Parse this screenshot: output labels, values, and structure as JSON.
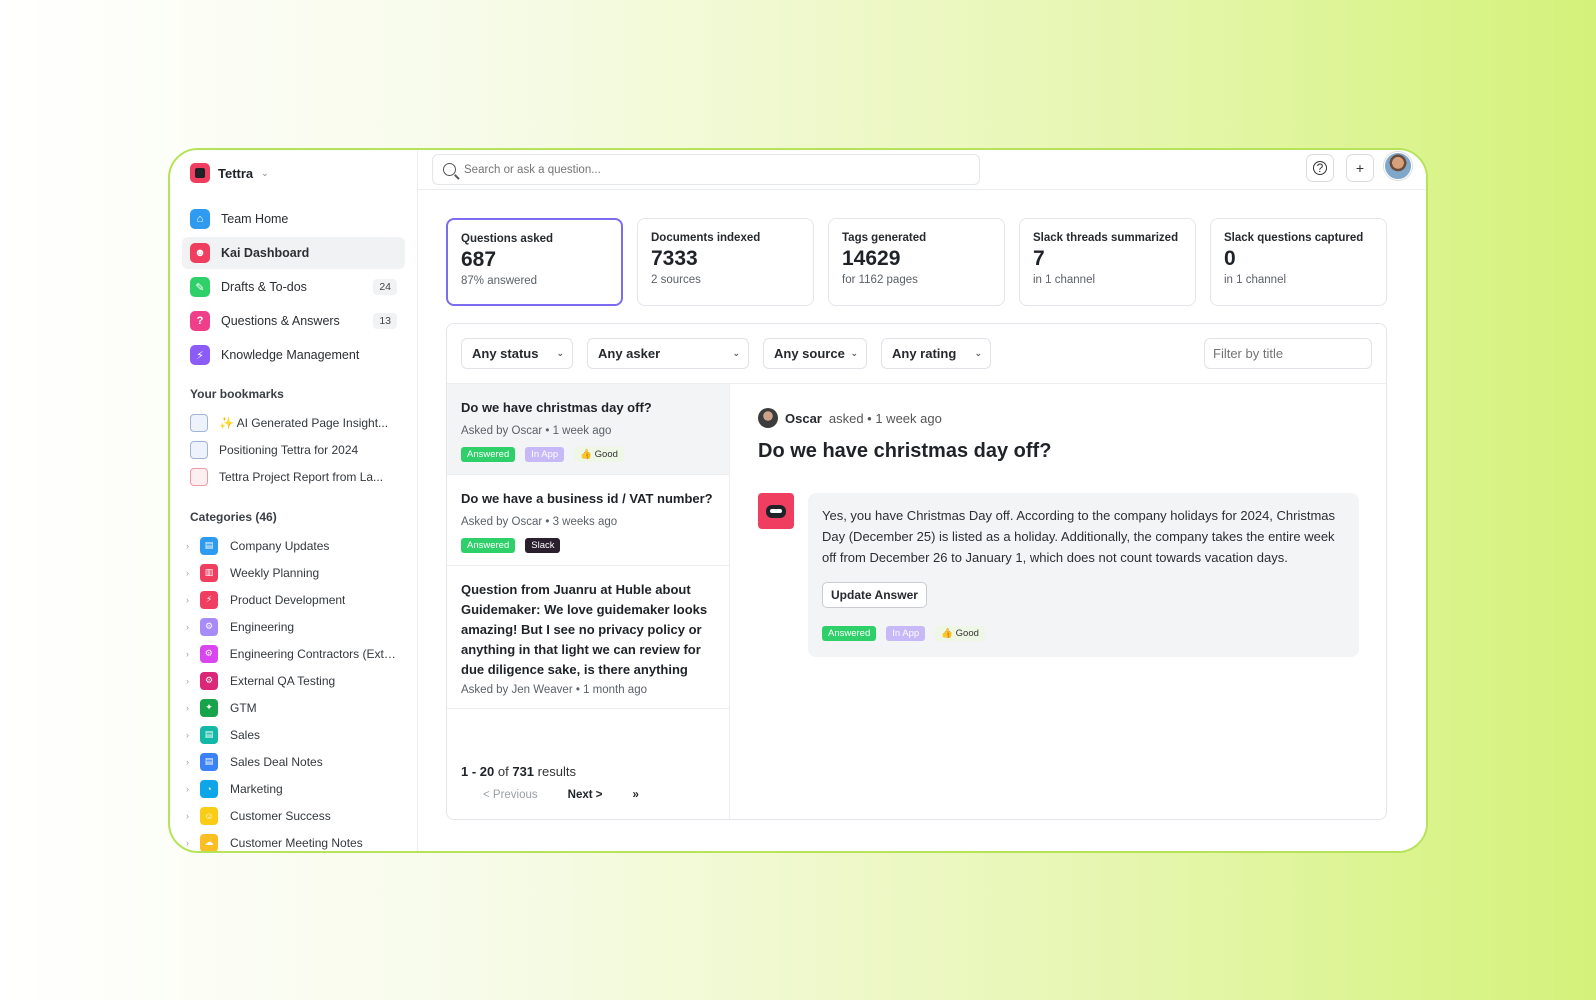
{
  "brand": {
    "name": "Tettra"
  },
  "nav": [
    {
      "label": "Team Home",
      "icon": "home-icon",
      "color": "#2e9bf0",
      "count": ""
    },
    {
      "label": "Kai Dashboard",
      "icon": "robot-icon",
      "color": "#ef3e5f",
      "count": ""
    },
    {
      "label": "Drafts & To-dos",
      "icon": "pencil-icon",
      "color": "#2fd06a",
      "count": "24"
    },
    {
      "label": "Questions & Answers",
      "icon": "question-icon",
      "color": "#ef3e8a",
      "count": "13"
    },
    {
      "label": "Knowledge Management",
      "icon": "lightning-icon",
      "color": "#8b5cf6",
      "count": ""
    }
  ],
  "bookmarks": {
    "title": "Your bookmarks",
    "items": [
      {
        "label": "✨ AI Generated Page Insight...",
        "icon": "doc-icon"
      },
      {
        "label": "Positioning Tettra for 2024",
        "icon": "doc-icon"
      },
      {
        "label": "Tettra Project Report from La...",
        "icon": "pdf-icon"
      }
    ]
  },
  "categories": {
    "title": "Categories (46)",
    "items": [
      {
        "label": "Company Updates",
        "color": "#2e9bf0"
      },
      {
        "label": "Weekly Planning",
        "color": "#ef3e5f"
      },
      {
        "label": "Product Development",
        "color": "#ef3e5f"
      },
      {
        "label": "Engineering",
        "color": "#a78bfa"
      },
      {
        "label": "Engineering Contractors (Exte...",
        "color": "#d946ef"
      },
      {
        "label": "External QA Testing",
        "color": "#db2777"
      },
      {
        "label": "GTM",
        "color": "#16a34a"
      },
      {
        "label": "Sales",
        "color": "#14b8a6"
      },
      {
        "label": "Sales Deal Notes",
        "color": "#3b82f6"
      },
      {
        "label": "Marketing",
        "color": "#0ea5e9"
      },
      {
        "label": "Customer Success",
        "color": "#facc15"
      },
      {
        "label": "Customer Meeting Notes",
        "color": "#fbbf24"
      }
    ]
  },
  "search": {
    "placeholder": "Search or ask a question..."
  },
  "stats": [
    {
      "title": "Questions asked",
      "value": "687",
      "sub": "87% answered"
    },
    {
      "title": "Documents indexed",
      "value": "7333",
      "sub": "2 sources"
    },
    {
      "title": "Tags generated",
      "value": "14629",
      "sub": "for 1162 pages"
    },
    {
      "title": "Slack threads summarized",
      "value": "7",
      "sub": "in 1 channel"
    },
    {
      "title": "Slack questions captured",
      "value": "0",
      "sub": "in 1 channel"
    }
  ],
  "filters": {
    "status": "Any status",
    "asker": "Any asker",
    "source": "Any source",
    "rating": "Any rating",
    "title_placeholder": "Filter by title"
  },
  "questions": [
    {
      "title": "Do we have christmas day off?",
      "meta": "Asked by Oscar  •  1 week ago",
      "tags": [
        "Answered",
        "In App",
        "👍 Good"
      ]
    },
    {
      "title": "Do we have a business id / VAT number?",
      "meta": "Asked by Oscar  •  3 weeks ago",
      "tags": [
        "Answered",
        "Slack"
      ]
    },
    {
      "title": "Question from Juanru at Huble about Guidemaker: We love guidemaker looks amazing! But I see no privacy policy or anything in that light we can review for due diligence sake, is there anything",
      "meta": "Asked by Jen Weaver  •  1 month ago"
    }
  ],
  "pager": {
    "range": "1 - 20",
    "of": "of",
    "total": "731",
    "results": "results",
    "prev": "< Previous",
    "next": "Next >",
    "last": "»"
  },
  "detail": {
    "asker": "Oscar",
    "asked": "asked • 1 week ago",
    "title": "Do we have christmas day off?",
    "answer": "Yes, you have Christmas Day off. According to the company holidays for 2024, Christmas Day (December 25) is listed as a holiday. Additionally, the company takes the entire week off from December 26 to January 1, which does not count towards vacation days.",
    "update_label": "Update Answer",
    "tags": [
      "Answered",
      "In App",
      "👍 Good"
    ]
  }
}
